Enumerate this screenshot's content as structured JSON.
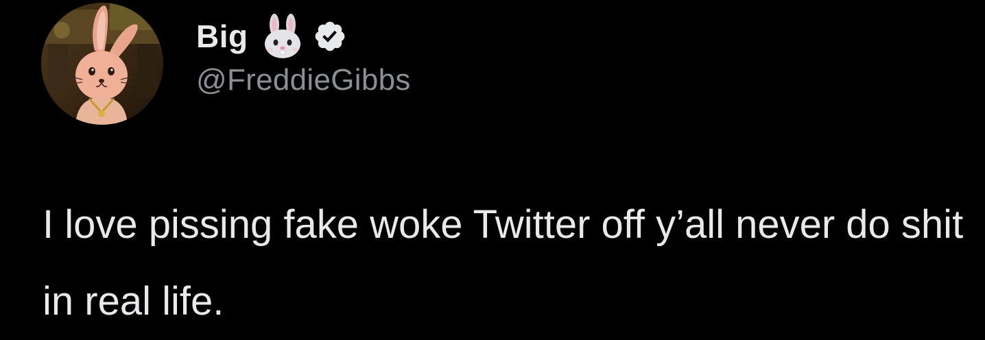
{
  "author": {
    "display_name": "Big",
    "emoji_icon": "rabbit-face-icon",
    "verified_icon": "verified-badge-icon",
    "handle": "@FreddieGibbs"
  },
  "tweet": {
    "text": "I love pissing fake woke Twitter off y’all never do shit in real life."
  },
  "colors": {
    "background": "#000000",
    "text": "#e7e9ea",
    "secondary_text": "#8b8f94"
  }
}
